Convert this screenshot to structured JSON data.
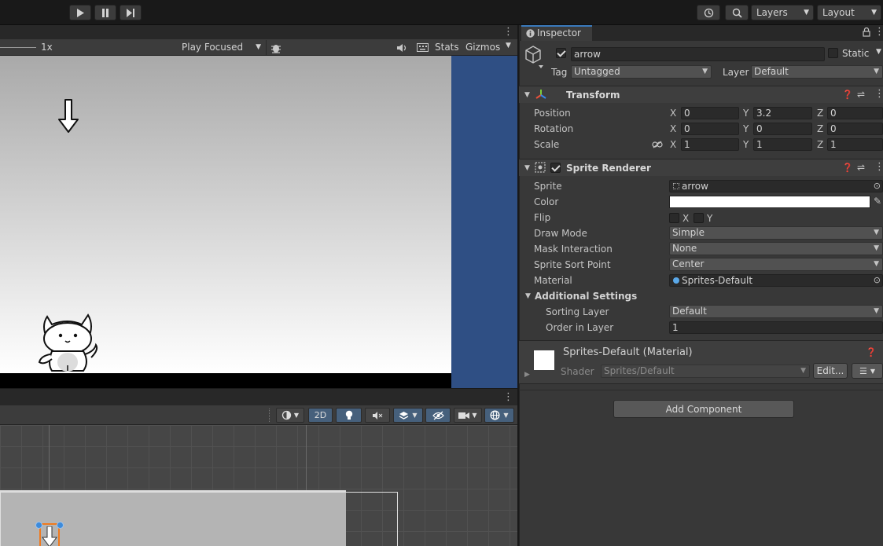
{
  "toolbar": {
    "layers_label": "Layers",
    "layout_label": "Layout"
  },
  "game": {
    "scale_label": "1x",
    "play_focused_label": "Play Focused",
    "stats_label": "Stats",
    "gizmos_label": "Gizmos"
  },
  "scene": {
    "mode_2d_label": "2D"
  },
  "inspector": {
    "tab_label": "Inspector",
    "object_name": "arrow",
    "static_label": "Static",
    "tag_label": "Tag",
    "tag_value": "Untagged",
    "layer_label": "Layer",
    "layer_value": "Default",
    "transform": {
      "title": "Transform",
      "position_label": "Position",
      "rotation_label": "Rotation",
      "scale_label": "Scale",
      "axis_x": "X",
      "axis_y": "Y",
      "axis_z": "Z",
      "position": {
        "x": "0",
        "y": "3.2",
        "z": "0"
      },
      "rotation": {
        "x": "0",
        "y": "0",
        "z": "0"
      },
      "scale": {
        "x": "1",
        "y": "1",
        "z": "1"
      }
    },
    "sprite_renderer": {
      "title": "Sprite Renderer",
      "sprite_label": "Sprite",
      "sprite_value": "arrow",
      "color_label": "Color",
      "color_value": "#ffffff",
      "flip_label": "Flip",
      "flip_x": "X",
      "flip_y": "Y",
      "draw_mode_label": "Draw Mode",
      "draw_mode_value": "Simple",
      "mask_label": "Mask Interaction",
      "mask_value": "None",
      "sort_point_label": "Sprite Sort Point",
      "sort_point_value": "Center",
      "material_label": "Material",
      "material_value": "Sprites-Default",
      "additional_label": "Additional Settings",
      "sorting_layer_label": "Sorting Layer",
      "sorting_layer_value": "Default",
      "order_label": "Order in Layer",
      "order_value": "1"
    },
    "material": {
      "title": "Sprites-Default (Material)",
      "shader_label": "Shader",
      "shader_value": "Sprites/Default",
      "edit_label": "Edit..."
    },
    "add_component_label": "Add Component"
  },
  "colors": {
    "accent": "#3a79bb",
    "scene_active": "#46607c",
    "game_background": "#2f4f84",
    "selection_orange": "#f07a1e"
  }
}
